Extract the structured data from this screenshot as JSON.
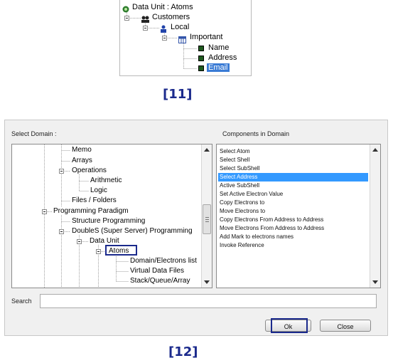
{
  "figure11": {
    "root": "Data Unit : Atoms",
    "customers": "Customers",
    "local": "Local",
    "important": "Important",
    "fields": [
      "Name",
      "Address",
      "Email"
    ],
    "selected_field": "Email"
  },
  "caption11": "[11]",
  "dialog": {
    "select_domain_label": "Select Domain :",
    "components_label": "Components in Domain",
    "tree": {
      "memo": "Memo",
      "arrays": "Arrays",
      "operations": "Operations",
      "arithmetic": "Arithmetic",
      "logic": "Logic",
      "files": "Files / Folders",
      "paradigm": "Programming Paradigm",
      "structure": "Structure Programming",
      "doubles": "DoubleS (Super Server) Programming",
      "data_unit": "Data Unit",
      "atoms": "Atoms",
      "domain_electrons": "Domain/Electrons list",
      "virtual_files": "Virtual Data Files",
      "stack": "Stack/Queue/Array"
    },
    "components": [
      "Select Atom",
      "Select Shell",
      "Select SubShell",
      "Select Address",
      "Active SubShell",
      "Set Active Electron Value",
      "Copy Electrons to",
      "Move Electrons to",
      "Copy Electrons From Address to Address",
      "Move Electrons From Address to Address",
      "Add Mark to electrons names",
      "Invoke Reference"
    ],
    "selected_component": "Select Address",
    "search_label": "Search",
    "search_value": "",
    "ok_label": "Ok",
    "close_label": "Close"
  },
  "caption12": "[12]",
  "colors": {
    "highlight_border": "#1b2a8c",
    "selection": "#3399ff"
  }
}
